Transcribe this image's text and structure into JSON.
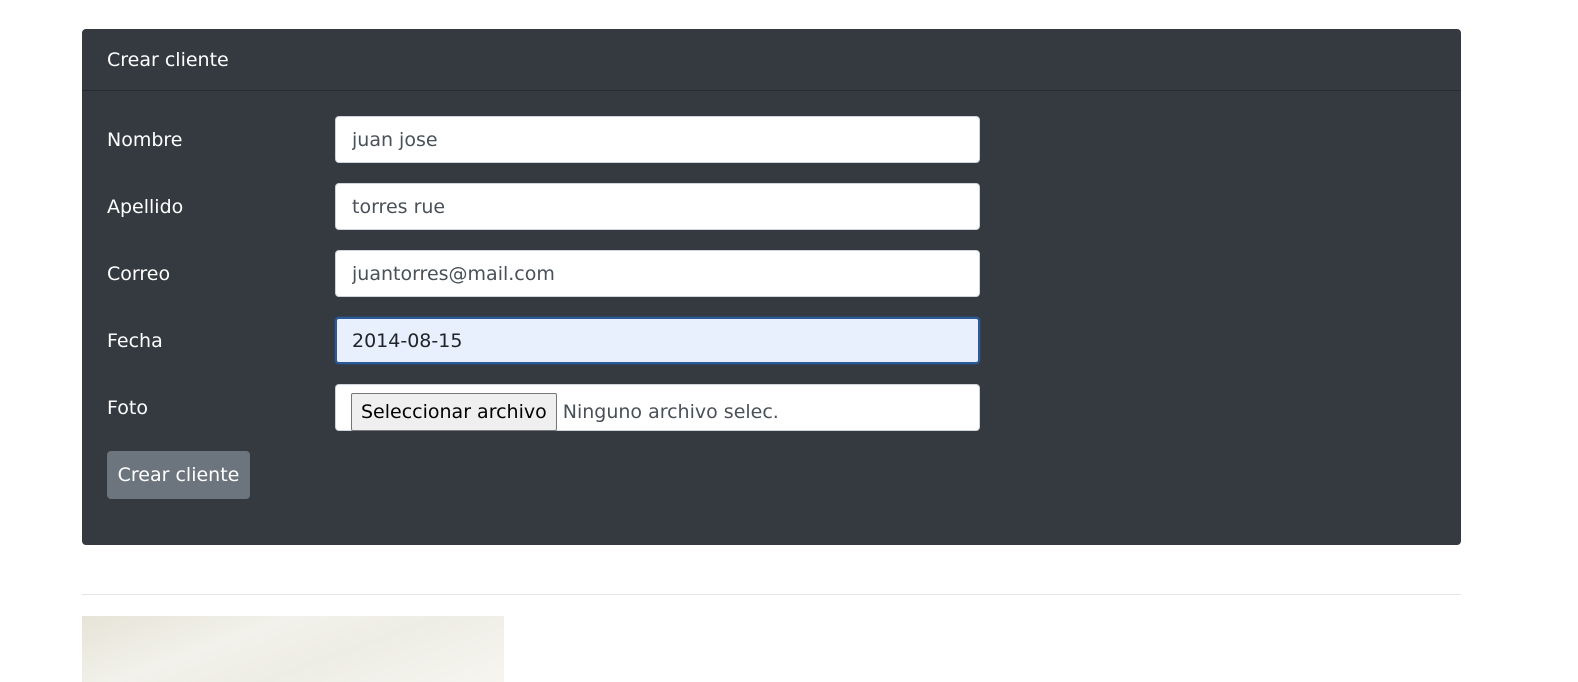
{
  "card": {
    "title": "Crear cliente"
  },
  "form": {
    "nombre": {
      "label": "Nombre",
      "value": "juan jose"
    },
    "apellido": {
      "label": "Apellido",
      "value": "torres rue"
    },
    "correo": {
      "label": "Correo",
      "value": "juantorres@mail.com"
    },
    "fecha": {
      "label": "Fecha",
      "value": "2014-08-15"
    },
    "foto": {
      "label": "Foto",
      "button_label": "Seleccionar archivo",
      "status": "Ninguno archivo selec."
    },
    "submit_label": "Crear cliente"
  },
  "colors": {
    "card_bg": "#343a40",
    "submit_bg": "#6c757d",
    "focus_bg": "#e8f0fe"
  }
}
